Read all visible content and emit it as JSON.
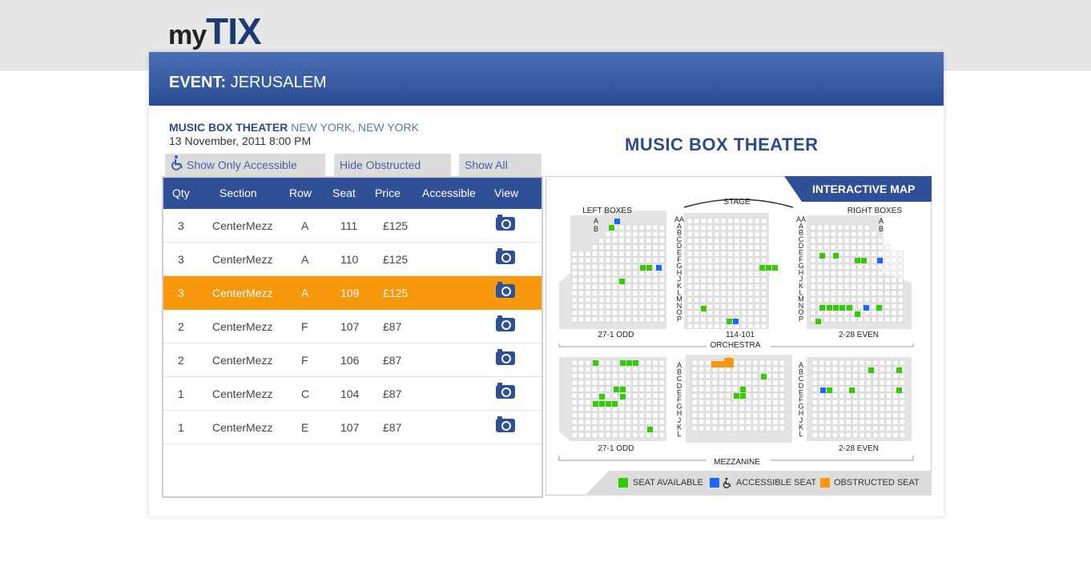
{
  "logo": {
    "my": "my",
    "tix": "TIX"
  },
  "event": {
    "label": "EVENT:",
    "name": "JERUSALEM"
  },
  "venue": {
    "name": "MUSIC BOX THEATER",
    "city": "NEW YORK, NEW YORK",
    "date": "13 November, 2011 8:00 PM"
  },
  "filters": {
    "accessible": "Show Only Accessible Seats",
    "hide_obstructed": "Hide Obstructed Seats",
    "show_all": "Show All Seats"
  },
  "table": {
    "headers": [
      "Qty",
      "Section",
      "Row",
      "Seat",
      "Price",
      "Accessible",
      "View"
    ],
    "rows": [
      {
        "qty": "3",
        "section": "CenterMezz",
        "row": "A",
        "seat": "111",
        "price": "£125",
        "selected": false
      },
      {
        "qty": "3",
        "section": "CenterMezz",
        "row": "A",
        "seat": "110",
        "price": "£125",
        "selected": false
      },
      {
        "qty": "3",
        "section": "CenterMezz",
        "row": "A",
        "seat": "109",
        "price": "£125",
        "selected": true
      },
      {
        "qty": "2",
        "section": "CenterMezz",
        "row": "F",
        "seat": "107",
        "price": "£87",
        "selected": false
      },
      {
        "qty": "2",
        "section": "CenterMezz",
        "row": "F",
        "seat": "106",
        "price": "£87",
        "selected": false
      },
      {
        "qty": "1",
        "section": "CenterMezz",
        "row": "C",
        "seat": "104",
        "price": "£87",
        "selected": false
      },
      {
        "qty": "1",
        "section": "CenterMezz",
        "row": "E",
        "seat": "107",
        "price": "£87",
        "selected": false
      }
    ]
  },
  "map": {
    "title": "MUSIC BOX THEATER",
    "tab": "INTERACTIVE MAP",
    "labels": {
      "stage": "STAGE",
      "left_boxes": "LEFT BOXES",
      "right_boxes": "RIGHT BOXES",
      "orch_left": "27-1 ODD",
      "orch_center": "114-101",
      "orch_right": "2-28 EVEN",
      "orchestra": "ORCHESTRA",
      "mezz_left": "27-1 ODD",
      "mezz_right": "2-28 EVEN",
      "mezzanine": "MEZZANINE"
    },
    "orch_rows": [
      "AA",
      "A",
      "B",
      "C",
      "D",
      "E",
      "F",
      "G",
      "H",
      "J",
      "K",
      "L",
      "M",
      "N",
      "O",
      "P"
    ],
    "mezz_rows": [
      "A",
      "B",
      "C",
      "D",
      "E",
      "F",
      "G",
      "H",
      "J",
      "K",
      "L"
    ],
    "box_rows": [
      "A",
      "B"
    ]
  },
  "legend": {
    "available": "SEAT AVAILABLE",
    "accessible": "ACCESSIBLE SEAT",
    "obstructed": "OBSTRUCTED SEAT"
  },
  "colors": {
    "brand": "#2f4f97",
    "selected": "#f7970c",
    "available": "#33cc00",
    "accessible": "#1a66ff",
    "obstructed": "#f7970c",
    "seat": "#d9d9d9"
  }
}
